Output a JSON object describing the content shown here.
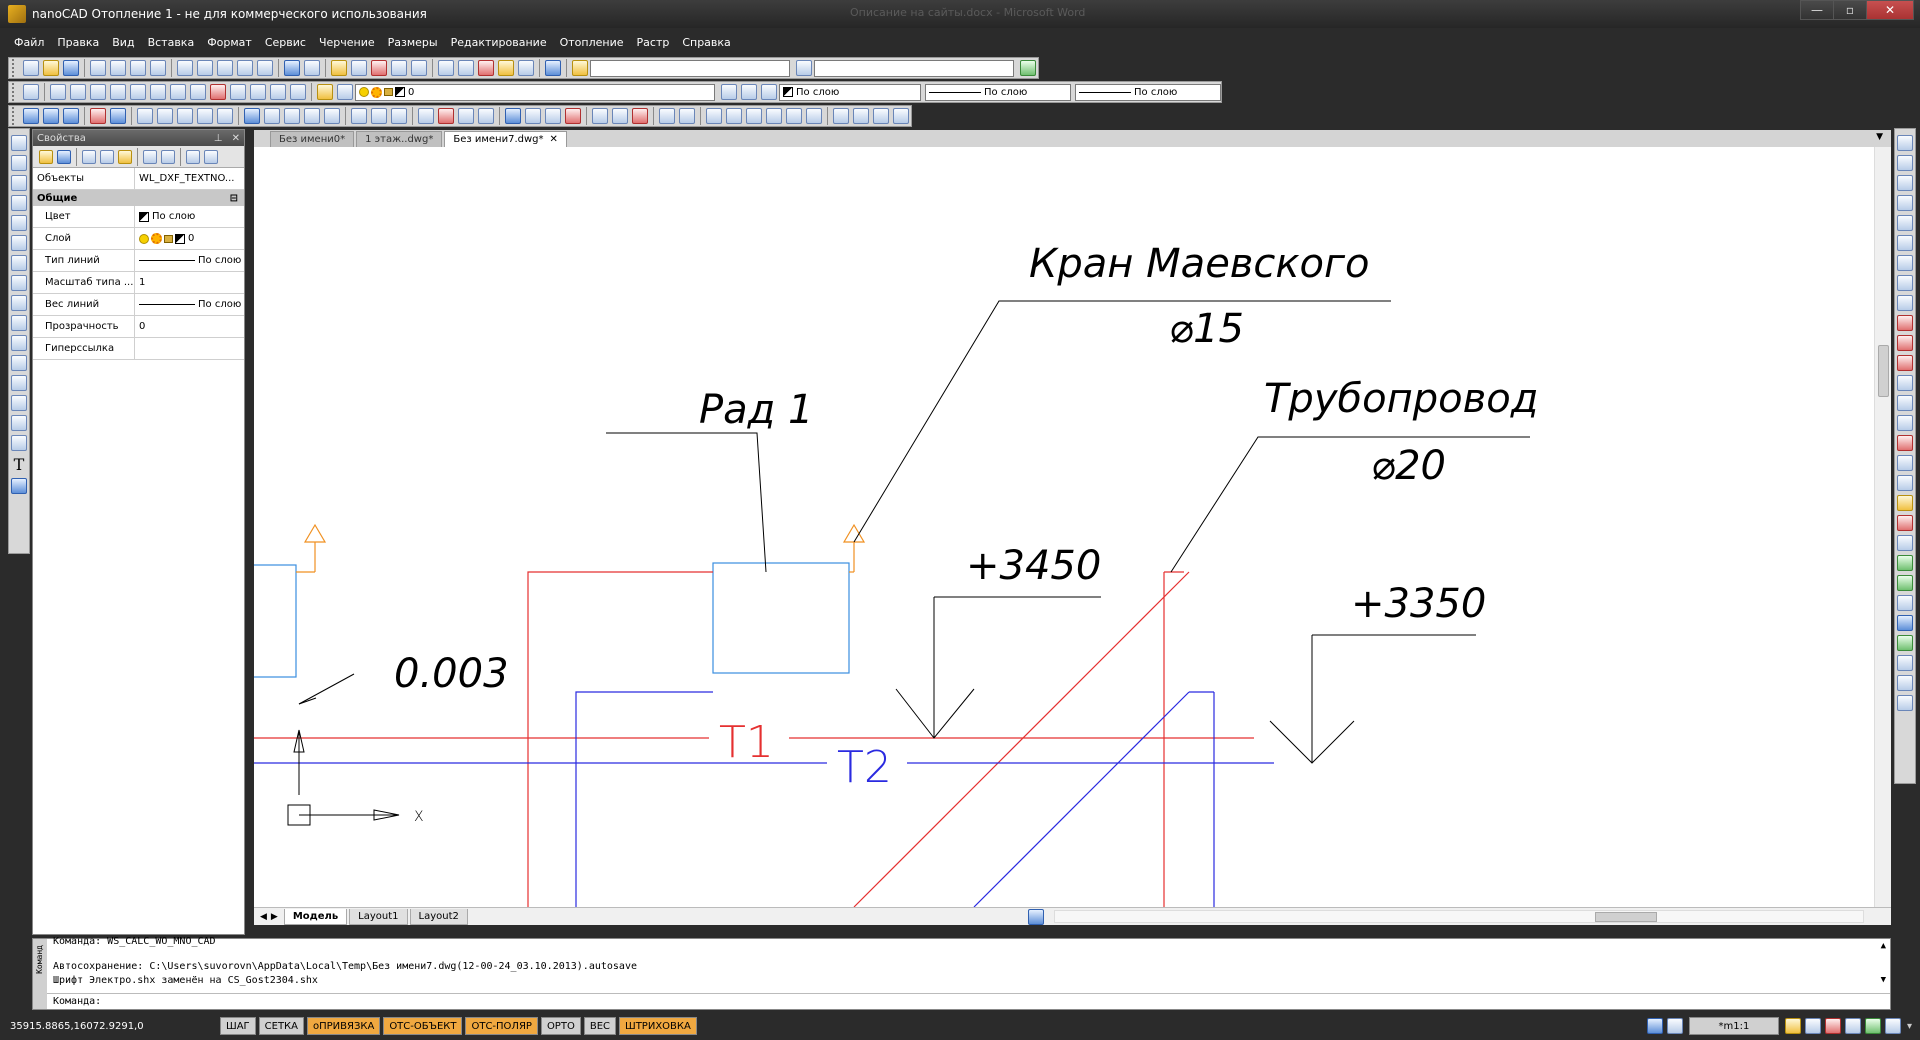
{
  "window": {
    "title": "nanoCAD Отопление 1 - не для коммерческого использования",
    "background_title": "Описание на сайты.docx - Microsoft Word",
    "min": "—",
    "max": "▫",
    "close": "✕"
  },
  "menu": [
    "Файл",
    "Правка",
    "Вид",
    "Вставка",
    "Формат",
    "Сервис",
    "Черчение",
    "Размеры",
    "Редактирование",
    "Отопление",
    "Растр",
    "Справка"
  ],
  "toolbar": {
    "layer_value": "0",
    "color_value": "По слою",
    "linetype_value": "По слою",
    "lineweight_value": "По слою"
  },
  "properties": {
    "title": "Свойства",
    "pin": "⊥",
    "close": "✕",
    "objects_label": "Объекты",
    "objects_value": "WL_DXF_TEXTNO...",
    "section": "Общие",
    "collapse": "⊟",
    "rows": [
      {
        "label": "Цвет",
        "value": "По слою"
      },
      {
        "label": "Слой",
        "value": "0"
      },
      {
        "label": "Тип линий",
        "value": "По слою"
      },
      {
        "label": "Масштаб типа ...",
        "value": "1"
      },
      {
        "label": "Вес линий",
        "value": "По слою"
      },
      {
        "label": "Прозрачность",
        "value": "0"
      },
      {
        "label": "Гиперссылка",
        "value": ""
      }
    ]
  },
  "doc_tabs": [
    {
      "label": "Без имени0*",
      "active": false
    },
    {
      "label": "1 этаж..dwg*",
      "active": false
    },
    {
      "label": "Без имени7.dwg*",
      "active": true
    }
  ],
  "doc_tab_close": "✕",
  "drawing": {
    "label_valve": "Кран Маевского",
    "label_valve_dia": "⌀15",
    "label_pipe": "Трубопровод",
    "label_pipe_dia": "⌀20",
    "label_rad": "Рад 1",
    "level_1": "+3450",
    "level_2": "+3350",
    "slope": "0.003",
    "pipe_1": "Т1",
    "pipe_2": "Т2",
    "axis_x": "X",
    "colors": {
      "supply": "#e53030",
      "return": "#2a2ae0",
      "radiator": "#3a8ee0",
      "marker": "#f09020"
    }
  },
  "layout_tabs": [
    {
      "label": "Модель",
      "active": true
    },
    {
      "label": "Layout1",
      "active": false
    },
    {
      "label": "Layout2",
      "active": false
    }
  ],
  "command": {
    "side_label": "Команд",
    "lines": [
      "Команда: WS_CALC_WO_MNO_CAD",
      "Автосохранение: C:\\Users\\suvorovn\\AppData\\Local\\Temp\\Без имени7.dwg(12-00-24_03.10.2013).autosave",
      "Шрифт Электро.shx заменён на CS_Gost2304.shx"
    ],
    "prompt": "Команда:"
  },
  "status": {
    "coords": "35915.8865,16072.9291,0",
    "buttons": [
      {
        "label": "ШАГ",
        "on": false
      },
      {
        "label": "СЕТКА",
        "on": false
      },
      {
        "label": "оПРИВЯЗКА",
        "on": true
      },
      {
        "label": "ОТС-ОБЪЕКТ",
        "on": true
      },
      {
        "label": "ОТС-ПОЛЯР",
        "on": true
      },
      {
        "label": "ОРТО",
        "on": false
      },
      {
        "label": "ВЕС",
        "on": false
      },
      {
        "label": "ШТРИХОВКА",
        "on": true
      }
    ],
    "scale": "*m1:1"
  }
}
